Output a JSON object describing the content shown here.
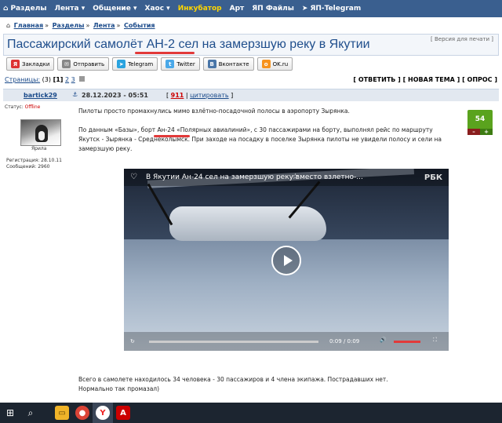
{
  "topnav": {
    "items": [
      "Разделы",
      "Лента",
      "Общение",
      "Хаос",
      "Инкубатор",
      "Арт",
      "ЯП Файлы",
      "ЯП-Telegram"
    ],
    "highlight_color": "#ffd600",
    "bg_color": "#3a5f8f"
  },
  "breadcrumb": {
    "items": [
      "Главная",
      "Разделы",
      "Лента",
      "События"
    ]
  },
  "post": {
    "title": "Пассажирский самолёт АН-2 сел на замерзшую реку в Якутии",
    "print_version": "[ Версия для печати ]",
    "share": [
      "Закладки",
      "Отправить",
      "Telegram",
      "Twitter",
      "Вконтакте",
      "OK.ru"
    ],
    "pages_label": "Страницы:",
    "pages_count": "(3)",
    "pages": [
      "[1]",
      "2",
      "3"
    ],
    "actions": "[ ОТВЕТИТЬ ] [ НОВАЯ ТЕМА ] [ ОПРОС ]",
    "author": "bartick29",
    "date": "28.12.2023 - 05:51",
    "number": "911",
    "quote": "цитировать",
    "status_label": "Статус:",
    "status_value": "Offline",
    "avatar_caption": "Ярила",
    "registration": "Регистрация: 28.10.11",
    "messages": "Сообщений: 2960",
    "rating": "54",
    "paragraph1": "Пилоты просто промахнулись мимо взлётно-посадочной полосы в аэропорту Зырянка.",
    "paragraph2": "По данным «Базы», борт Ан-24 «Полярных авиалиний», с 30 пассажирами на борту, выполнял рейс по маршруту Якутск - Зырянка - Среднеколымск. При заходе на посадку в поселке Зырянка пилоты не увидели полосу и сели на замерзшую реку.",
    "video_title": "В Якутии Ан-24 сел на замерзшую реку вместо взлетно-...",
    "video_time": "0:09 / 0:09",
    "footer1": "Всего в самолете находилось 34 человека - 30 пассажиров и 4 члена экипажа. Пострадавших нет.",
    "footer2": "Нормально так промазал)"
  }
}
